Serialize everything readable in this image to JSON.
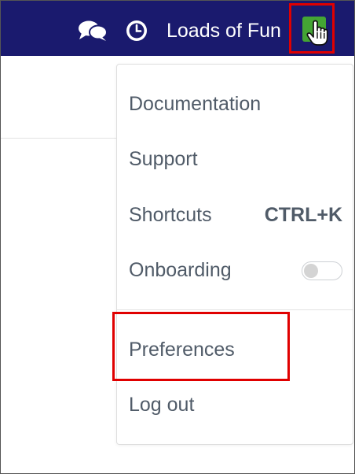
{
  "header": {
    "account_name": "Loads of Fun",
    "icons": {
      "chat": "chat-bubbles-icon",
      "clock": "clock-icon",
      "pointer": "hand-pointer-icon"
    },
    "colors": {
      "bar": "#1a1a6e",
      "avatar": "#44a534",
      "highlight": "#e00000"
    }
  },
  "menu": {
    "documentation": "Documentation",
    "support": "Support",
    "shortcuts": "Shortcuts",
    "shortcuts_key": "CTRL+K",
    "onboarding": "Onboarding",
    "onboarding_enabled": false,
    "preferences": "Preferences",
    "logout": "Log out"
  }
}
